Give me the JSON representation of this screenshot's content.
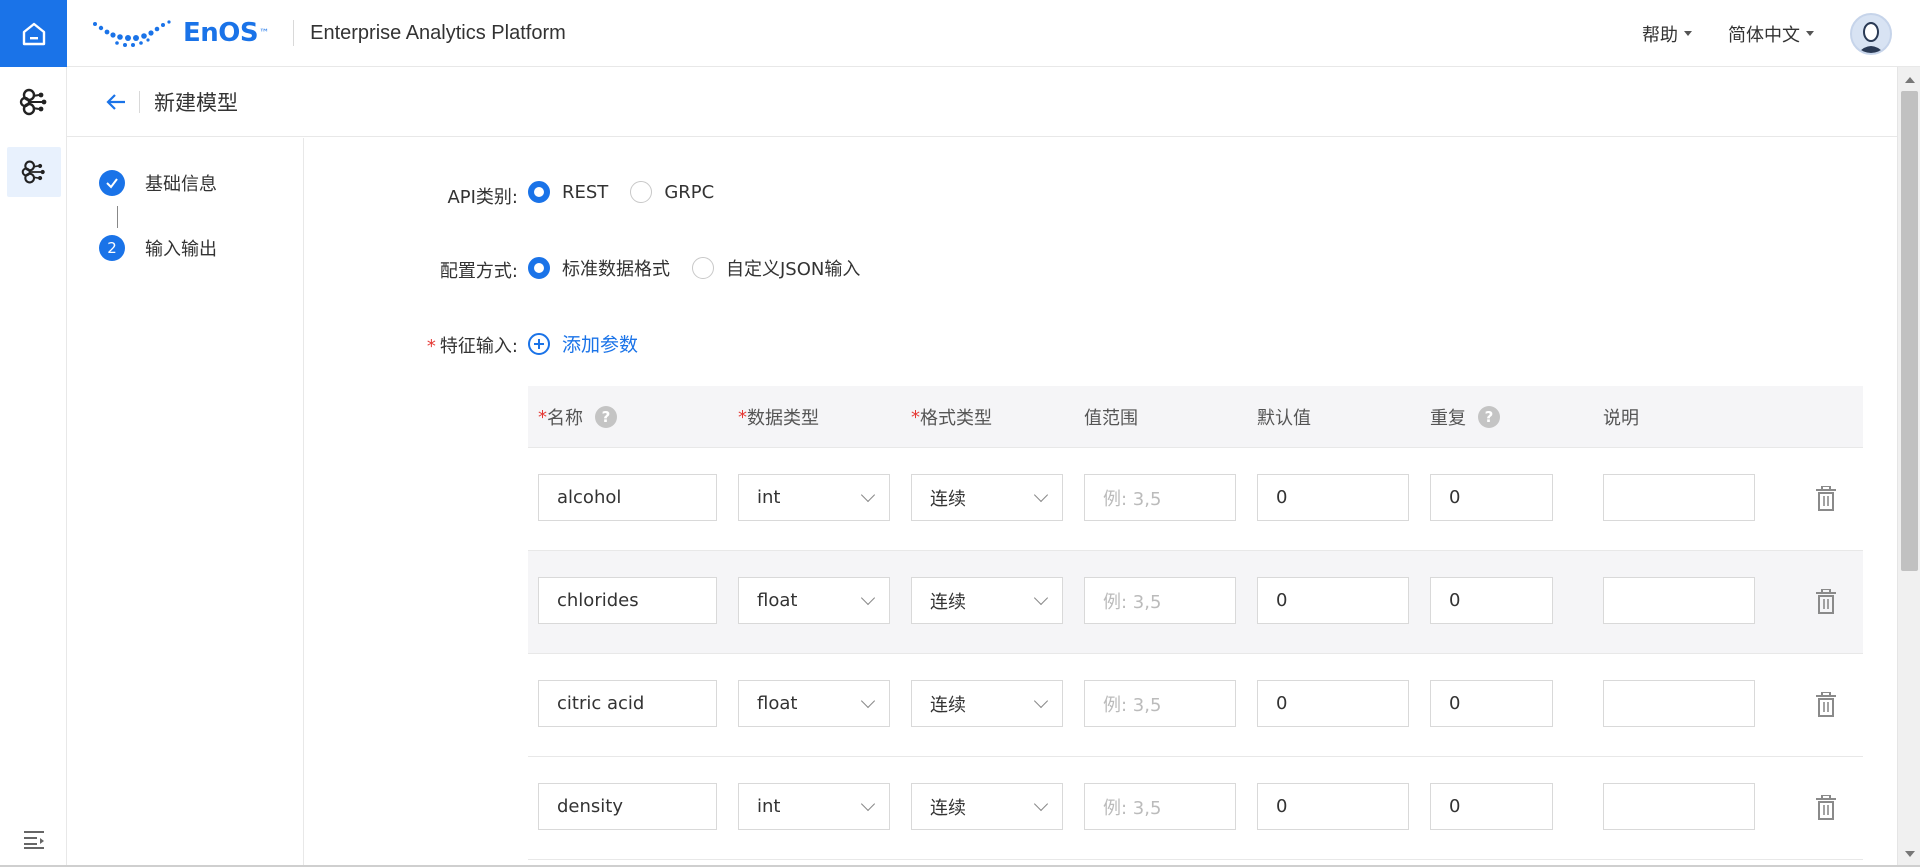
{
  "app": {
    "brand": "EnOS",
    "brand_tm": "™",
    "title": "Enterprise Analytics Platform",
    "menu_help": "帮助",
    "menu_lang": "简体中文"
  },
  "page": {
    "title": "新建模型"
  },
  "steps": [
    {
      "index": "✓",
      "label": "基础信息",
      "state": "done"
    },
    {
      "index": "2",
      "label": "输入输出",
      "state": "current"
    }
  ],
  "form": {
    "api_type_label": "API类别:",
    "api_options": [
      "REST",
      "GRPC"
    ],
    "api_selected": "REST",
    "config_label": "配置方式:",
    "config_options": [
      "标准数据格式",
      "自定义JSON输入"
    ],
    "config_selected": "标准数据格式",
    "feature_input_label": "特征输入:",
    "add_param": "添加参数"
  },
  "table": {
    "headers": {
      "name": "名称",
      "dtype": "数据类型",
      "format": "格式类型",
      "range": "值范围",
      "default": "默认值",
      "repeat": "重复",
      "desc": "说明"
    },
    "range_placeholder": "例: 3,5",
    "rows": [
      {
        "name": "alcohol",
        "dtype": "int",
        "format": "连续",
        "default": "0",
        "repeat": "0",
        "desc": ""
      },
      {
        "name": "chlorides",
        "dtype": "float",
        "format": "连续",
        "default": "0",
        "repeat": "0",
        "desc": ""
      },
      {
        "name": "citric acid",
        "dtype": "float",
        "format": "连续",
        "default": "0",
        "repeat": "0",
        "desc": ""
      },
      {
        "name": "density",
        "dtype": "int",
        "format": "连续",
        "default": "0",
        "repeat": "0",
        "desc": ""
      }
    ]
  },
  "colors": {
    "accent": "#1a73e8",
    "required": "#e53935",
    "header_bg": "#f5f5f7"
  }
}
